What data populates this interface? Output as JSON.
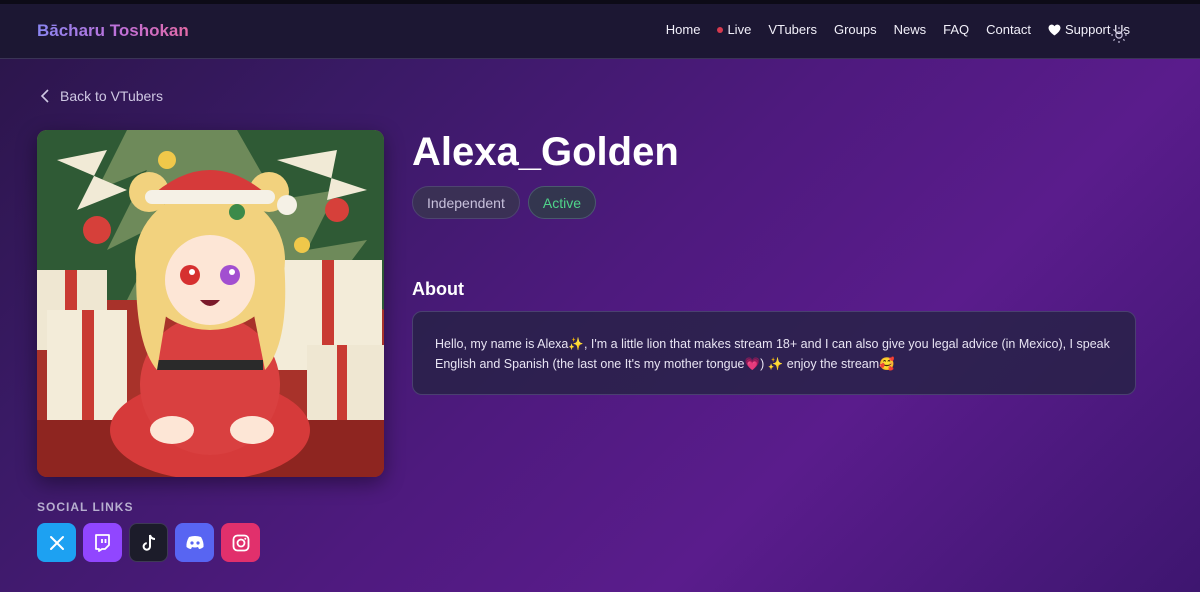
{
  "header": {
    "brand": "Bācharu Toshokan",
    "nav": [
      {
        "label": "Home"
      },
      {
        "label": "Live"
      },
      {
        "label": "VTubers"
      },
      {
        "label": "Groups"
      },
      {
        "label": "News"
      },
      {
        "label": "FAQ"
      },
      {
        "label": "Contact"
      },
      {
        "label": "Support Us"
      }
    ],
    "theme_toggle_icon": "sun-icon"
  },
  "back_link": "Back to VTubers",
  "profile": {
    "name": "Alexa_Golden",
    "badges": [
      "Independent",
      "Active"
    ],
    "about_heading": "About",
    "about_text": "Hello, my name is Alexa✨, I'm a little lion that makes stream 18+ and I can also give you legal advice (in Mexico), I speak English and Spanish (the last one It's my mother tongue💗) ✨ enjoy the stream🥰"
  },
  "social": {
    "heading": "SOCIAL LINKS",
    "links": [
      {
        "icon": "x-icon"
      },
      {
        "icon": "twitch-icon"
      },
      {
        "icon": "tiktok-icon"
      },
      {
        "icon": "discord-icon"
      },
      {
        "icon": "instagram-icon"
      }
    ]
  },
  "colors": {
    "accent_live": "#d63a4e",
    "active_badge": "#4fd48a",
    "x": "#1da1f2",
    "twitch": "#9146ff",
    "discord": "#5865f2",
    "instagram": "#e1306c"
  }
}
